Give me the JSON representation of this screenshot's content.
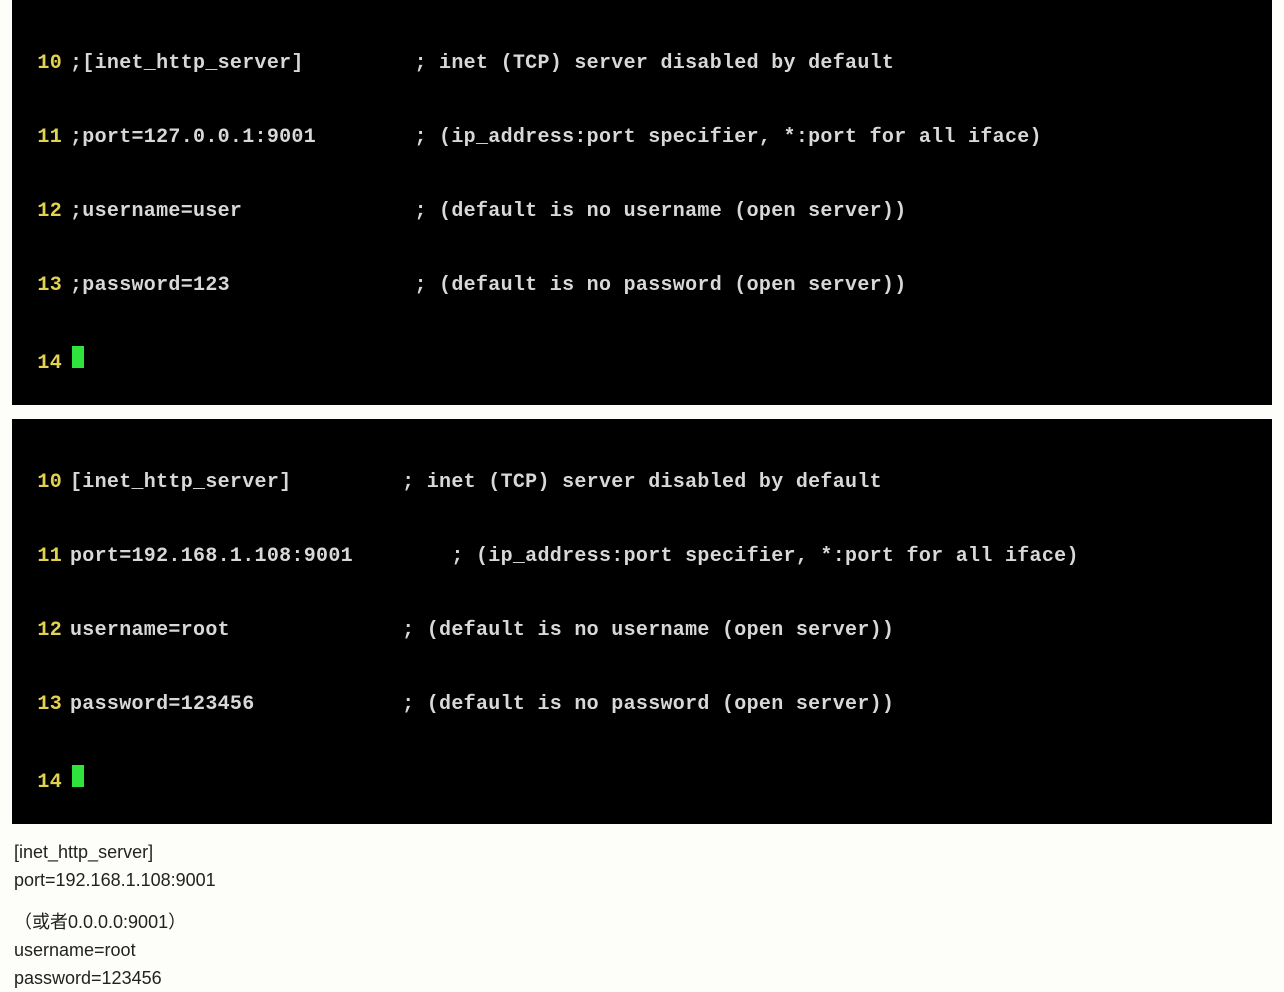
{
  "terminal1": {
    "lines": [
      {
        "num": "10",
        "text": ";[inet_http_server]         ; inet (TCP) server disabled by default"
      },
      {
        "num": "11",
        "text": ";port=127.0.0.1:9001        ; (ip_address:port specifier, *:port for all iface)"
      },
      {
        "num": "12",
        "text": ";username=user              ; (default is no username (open server))"
      },
      {
        "num": "13",
        "text": ";password=123               ; (default is no password (open server))"
      },
      {
        "num": "14",
        "text": ""
      }
    ]
  },
  "terminal2": {
    "lines": [
      {
        "num": "10",
        "text": "[inet_http_server]         ; inet (TCP) server disabled by default"
      },
      {
        "num": "11",
        "text": "port=192.168.1.108:9001        ; (ip_address:port specifier, *:port for all iface)"
      },
      {
        "num": "12",
        "text": "username=root              ; (default is no username (open server))"
      },
      {
        "num": "13",
        "text": "password=123456            ; (default is no password (open server))"
      },
      {
        "num": "14",
        "text": ""
      }
    ]
  },
  "doc": {
    "line1": "[inet_http_server]",
    "line2": "port=192.168.1.108:9001",
    "line3": "（或者0.0.0.0:9001）",
    "line4": "username=root",
    "line5": "password=123456"
  }
}
